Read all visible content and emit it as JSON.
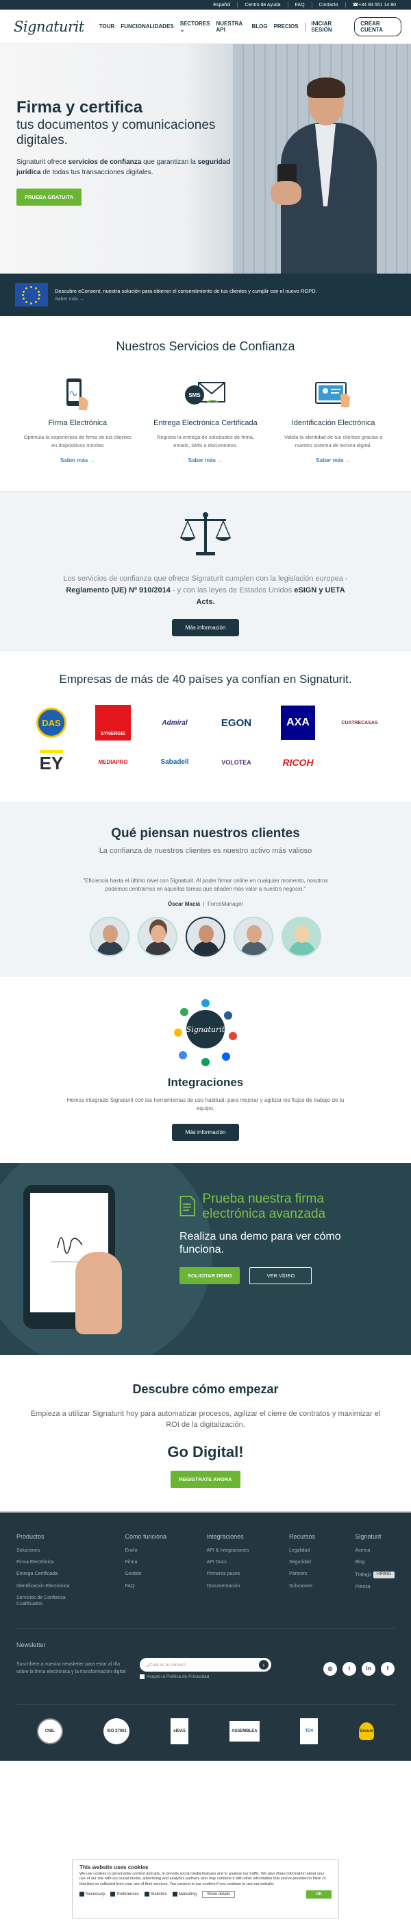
{
  "topbar": {
    "lang": "Español",
    "help": "Centro de Ayuda",
    "faq": "FAQ",
    "contact": "Contacto",
    "phone": "+34 93 551 14 80"
  },
  "header": {
    "logo": "Signaturit",
    "nav": [
      "TOUR",
      "FUNCIONALIDADES",
      "SECTORES",
      "NUESTRA API",
      "BLOG",
      "PRECIOS"
    ],
    "login": "INICIAR SESIÓN",
    "signup": "CREAR CUENTA"
  },
  "hero": {
    "title": "Firma y certifica",
    "subtitle": "tus documentos y comunicaciones digitales.",
    "p_pre": "Signaturit ofrece ",
    "p_b1": "servicios de confianza",
    "p_mid": " que garantizan la ",
    "p_b2": "seguridad jurídica",
    "p_post": " de todas tus transacciones digitales.",
    "cta": "PRUEBA GRATUITA"
  },
  "eu_banner": {
    "text": "Descubre eConsent, nuestra solución para obtener el consentimiento de tus clientes y cumplir con el nuevo RGPD.",
    "link": "Saber más →"
  },
  "services": {
    "title": "Nuestros Servicios de Confianza",
    "items": [
      {
        "title": "Firma Electrónica",
        "desc": "Optimiza la experiencia de firma de tus clientes en dispositivos móviles",
        "more": "Saber más →",
        "icon": "phone-signature-icon"
      },
      {
        "title": "Entrega Electrónica Certificada",
        "desc": "Registra la entrega de solicitudes de firma, emails, SMS o documentos.",
        "more": "Saber más →",
        "icon": "sms-envelope-icon"
      },
      {
        "title": "Identificación Electrónica",
        "desc": "Valida la identidad de tus clientes gracias a nuestro sistema de lectura digital.",
        "more": "Saber más →",
        "icon": "id-card-icon"
      }
    ]
  },
  "legal": {
    "p1": "Los servicios de confianza que ofrece Signaturit cumplen con la legislación europea - ",
    "b1": "Reglamento (UE) Nº 910/2014",
    "p2": " - y con las leyes de Estados Unidos ",
    "b2": "eSIGN y UETA Acts.",
    "cta": "Más información"
  },
  "clients": {
    "title": "Empresas de más de 40 países ya confían en Signaturit.",
    "logos": [
      "DAS",
      "SYNERGIE",
      "Admiral",
      "EGON",
      "AXA",
      "CUATRECASAS",
      "EY",
      "MEDIAPRO",
      "Sabadell",
      "VOLOTEA",
      "RICOH"
    ]
  },
  "testimonials": {
    "title": "Qué piensan nuestros clientes",
    "lead": "La confianza de nuestros clientes es nuestro activo más valioso",
    "quote": "\"Eficiencia hasta el último nivel con Signaturit. Al poder firmar online en cualquier momento, nosotros podemos centrarnos en aquellas tareas que añaden más valor a nuestro negocio.\"",
    "author": "Óscar Maciá",
    "company": "ForceManager"
  },
  "integrations": {
    "title": "Integraciones",
    "text": "Hemos integrado Signaturit con las herramientas de uso habitual, para mejorar y agilizar los flujos de trabajo de tu equipo.",
    "cta": "Más información"
  },
  "demo": {
    "title": "Prueba nuestra firma electrónica avanzada",
    "subtitle": "Realiza una demo para ver cómo funciona.",
    "btn1": "SOLICITAR DEMO",
    "btn2": "VER VÍDEO"
  },
  "start": {
    "title": "Descubre cómo empezar",
    "text": "Empieza a utilizar Signaturit hoy para automatizar procesos, agilizar el cierre de contratos y maximizar el ROI de la digitalización.",
    "go": "Go Digital!",
    "cta": "REGISTRATE AHORA"
  },
  "footer": {
    "cols": [
      {
        "title": "Productos",
        "links": [
          "Soluciones",
          "Firma Electrónica",
          "Entrega Certificada",
          "Identificación Electrónica",
          "Servicios de Confianza Cualificados"
        ]
      },
      {
        "title": "Cómo funciona",
        "links": [
          "Envío",
          "Firma",
          "Gestión",
          "FAQ"
        ]
      },
      {
        "title": "Integraciones",
        "links": [
          "API & Integraciones",
          "API Docs",
          "Primeros pasos",
          "Documentación"
        ]
      },
      {
        "title": "Recursos",
        "links": [
          "Legalidad",
          "Seguridad",
          "Partners",
          "Soluciones"
        ]
      },
      {
        "title": "Signaturit",
        "links": [
          "Acerca",
          "Blog",
          "Trabajo",
          "Prensa"
        ]
      }
    ],
    "hiring": "HIRING",
    "newsletter_title": "Newsletter",
    "newsletter_text": "Suscríbete a nuestra newsletter para estar al día sobre la firma electrónica y la transformación digital",
    "newsletter_placeholder": "¿Cuál es tu correo?",
    "privacy": "Acepto la Política de Privacidad",
    "certs": [
      "CNIL",
      "ISO 27001",
      "eIDAS",
      "ASSEMBLEA",
      "TÜV",
      "Secure"
    ]
  },
  "cookies": {
    "title": "This website uses cookies",
    "text": "We use cookies to personalise content and ads, to provide social media features and to analyse our traffic. We also share information about your use of our site with our social media, advertising and analytics partners who may combine it with other information that you've provided to them or that they've collected from your use of their services. You consent to our cookies if you continue to use our website.",
    "options": [
      "Necessary",
      "Preferences",
      "Statistics",
      "Marketing"
    ],
    "details": "Show details",
    "ok": "OK"
  },
  "colors": {
    "primary": "#1d3540",
    "accent": "#6ab533",
    "link": "#3a7dc4"
  }
}
